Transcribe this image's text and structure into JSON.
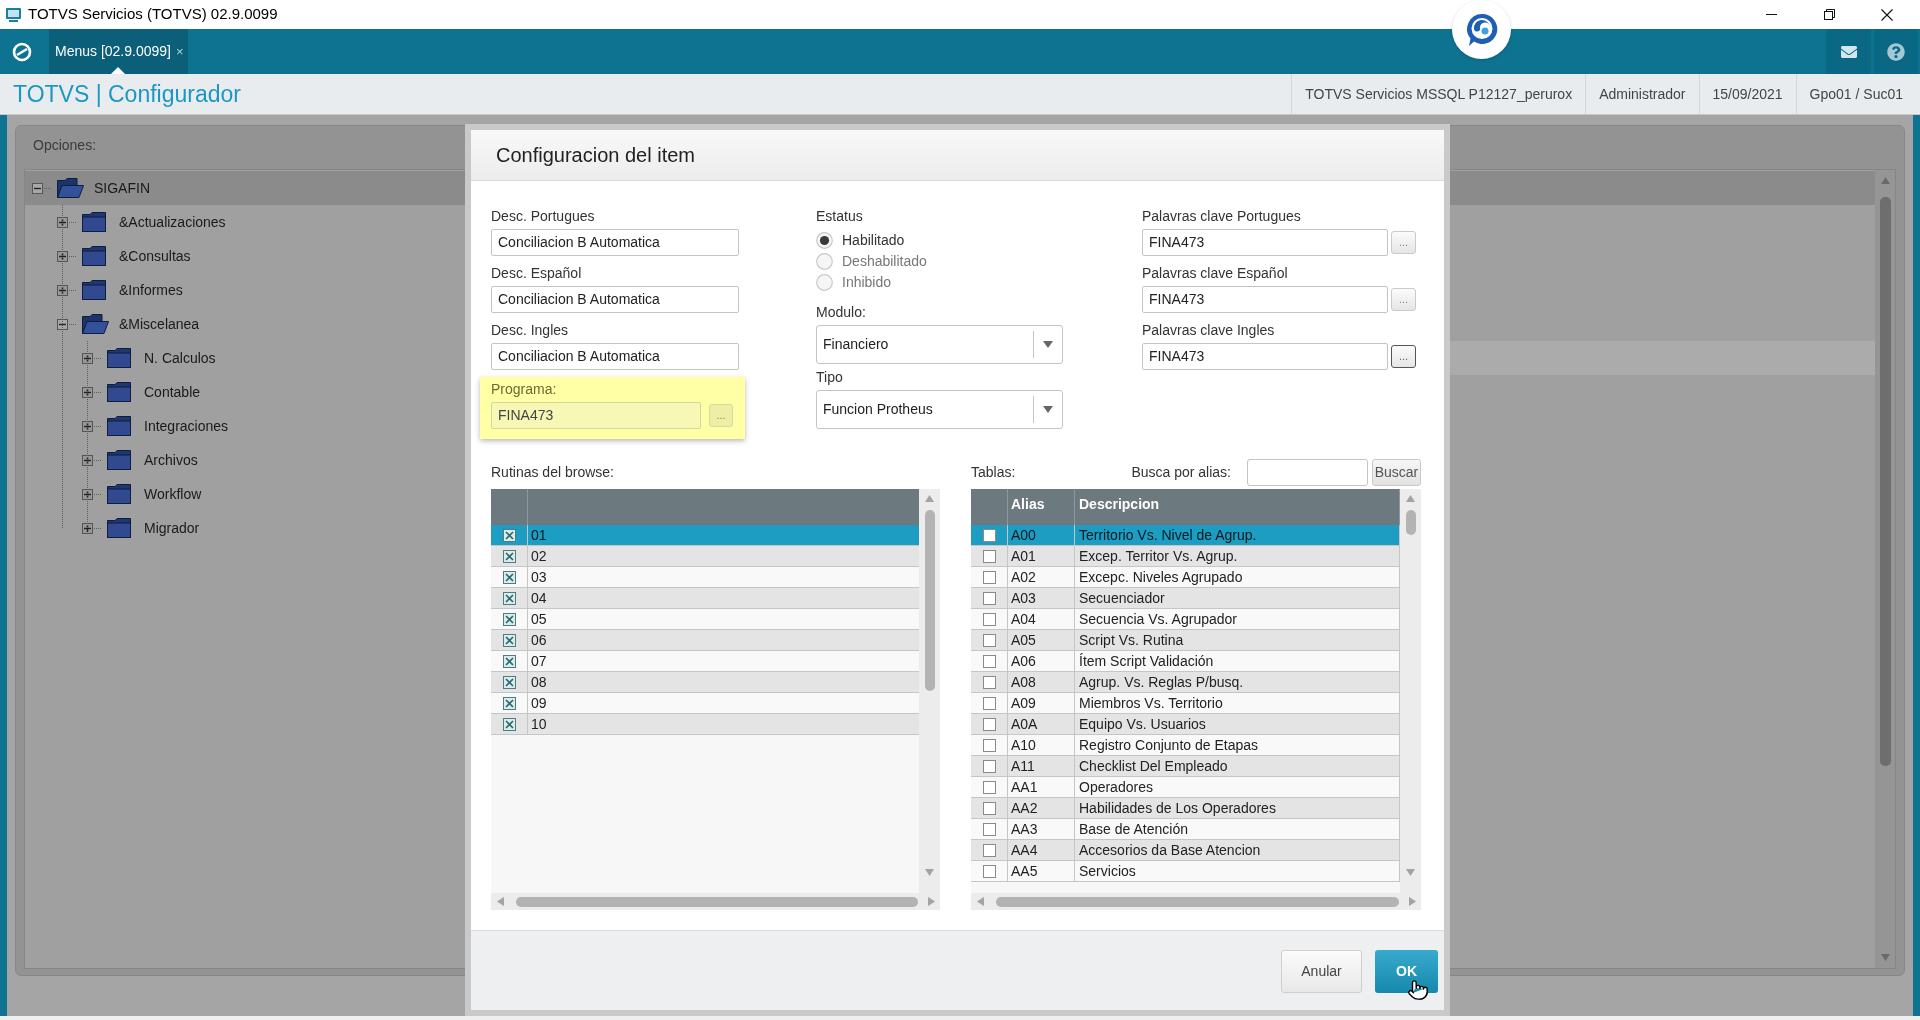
{
  "window": {
    "title": "TOTVS Servicios (TOTVS) 02.9.0099"
  },
  "tabs": [
    {
      "label": "Menus [02.9.0099]",
      "close": "×",
      "selected": true
    }
  ],
  "header": {
    "title": "TOTVS | Configurador",
    "info": [
      "TOTVS Servicios MSSQL P12127_perurox",
      "Administrador",
      "15/09/2021",
      "Gpo01 / Suc01"
    ]
  },
  "options_panel": {
    "title": "Opciones:",
    "tree": [
      {
        "label": "SIGAFIN",
        "expanded": true,
        "selected": true,
        "children": [
          {
            "label": "&Actualizaciones",
            "expanded": false,
            "selected": false
          },
          {
            "label": "&Consultas",
            "expanded": false,
            "selected": false
          },
          {
            "label": "&Informes",
            "expanded": false,
            "selected": false
          },
          {
            "label": "&Miscelanea",
            "expanded": true,
            "selected": false,
            "children": [
              {
                "label": "N. Calculos",
                "expanded": false,
                "selected": false
              },
              {
                "label": "Contable",
                "expanded": false,
                "selected": false
              },
              {
                "label": "Integraciones",
                "expanded": false,
                "selected": false
              },
              {
                "label": "Archivos",
                "expanded": false,
                "selected": false
              },
              {
                "label": "Workflow",
                "expanded": false,
                "selected": false
              },
              {
                "label": "Migrador",
                "expanded": false,
                "selected": false
              }
            ]
          }
        ]
      }
    ]
  },
  "dialog": {
    "title": "Configuracion del item",
    "descriptions": [
      {
        "label": "Desc. Portugues",
        "value": "Conciliacion B Automatica"
      },
      {
        "label": "Desc. Español",
        "value": "Conciliacion B Automatica"
      },
      {
        "label": "Desc. Ingles",
        "value": "Conciliacion B Automatica"
      }
    ],
    "program": {
      "label": "Programa:",
      "value": "FINA473",
      "button": "...",
      "highlighted": true
    },
    "status": {
      "label": "Estatus",
      "options": [
        {
          "label": "Habilitado",
          "selected": true
        },
        {
          "label": "Deshabilitado",
          "selected": false
        },
        {
          "label": "Inhibido",
          "selected": false
        }
      ]
    },
    "module": {
      "label": "Modulo:",
      "value": "Financiero"
    },
    "type": {
      "label": "Tipo",
      "value": "Funcion Protheus"
    },
    "keywords": [
      {
        "label": "Palavras clave Portugues",
        "value": "FINA473",
        "button": "...",
        "focused": false
      },
      {
        "label": "Palavras clave Español",
        "value": "FINA473",
        "button": "...",
        "focused": false
      },
      {
        "label": "Palavras clave Ingles",
        "value": "FINA473",
        "button": "...",
        "focused": true
      }
    ],
    "routines": {
      "label": "Rutinas del browse:",
      "rows": [
        {
          "value": "01",
          "checked": true,
          "selected": true
        },
        {
          "value": "02",
          "checked": true,
          "selected": false
        },
        {
          "value": "03",
          "checked": true,
          "selected": false
        },
        {
          "value": "04",
          "checked": true,
          "selected": false
        },
        {
          "value": "05",
          "checked": true,
          "selected": false
        },
        {
          "value": "06",
          "checked": true,
          "selected": false
        },
        {
          "value": "07",
          "checked": true,
          "selected": false
        },
        {
          "value": "08",
          "checked": true,
          "selected": false
        },
        {
          "value": "09",
          "checked": true,
          "selected": false
        },
        {
          "value": "10",
          "checked": true,
          "selected": false
        }
      ]
    },
    "tables": {
      "label": "Tablas:",
      "search": {
        "label": "Busca por alias:",
        "button": "Buscar"
      },
      "columns": [
        "Alias",
        "Descripcion"
      ],
      "rows": [
        {
          "alias": "A00",
          "description": "Territorio Vs. Nivel de Agrup.",
          "checked": false,
          "selected": true
        },
        {
          "alias": "A01",
          "description": "Excep. Territor Vs. Agrup.",
          "checked": false,
          "selected": false
        },
        {
          "alias": "A02",
          "description": "Excepc. Niveles Agrupado",
          "checked": false,
          "selected": false
        },
        {
          "alias": "A03",
          "description": "Secuenciador",
          "checked": false,
          "selected": false
        },
        {
          "alias": "A04",
          "description": "Secuencia Vs. Agrupador",
          "checked": false,
          "selected": false
        },
        {
          "alias": "A05",
          "description": "Script Vs. Rutina",
          "checked": false,
          "selected": false
        },
        {
          "alias": "A06",
          "description": "Ítem Script Validación",
          "checked": false,
          "selected": false
        },
        {
          "alias": "A08",
          "description": "Agrup. Vs. Reglas P/busq.",
          "checked": false,
          "selected": false
        },
        {
          "alias": "A09",
          "description": "Miembros Vs. Territorio",
          "checked": false,
          "selected": false
        },
        {
          "alias": "A0A",
          "description": "Equipo Vs. Usuarios",
          "checked": false,
          "selected": false
        },
        {
          "alias": "A10",
          "description": "Registro Conjunto de Etapas",
          "checked": false,
          "selected": false
        },
        {
          "alias": "A11",
          "description": "Checklist Del Empleado",
          "checked": false,
          "selected": false
        },
        {
          "alias": "AA1",
          "description": "Operadores",
          "checked": false,
          "selected": false
        },
        {
          "alias": "AA2",
          "description": "Habilidades de Los Operadores",
          "checked": false,
          "selected": false
        },
        {
          "alias": "AA3",
          "description": "Base de Atención",
          "checked": false,
          "selected": false
        },
        {
          "alias": "AA4",
          "description": "Accesorios da Base Atencion",
          "checked": false,
          "selected": false
        },
        {
          "alias": "AA5",
          "description": "Servicios",
          "checked": false,
          "selected": false
        }
      ]
    },
    "buttons": [
      {
        "label": "Anular",
        "kind": "secondary"
      },
      {
        "label": "OK",
        "kind": "primary"
      }
    ]
  }
}
